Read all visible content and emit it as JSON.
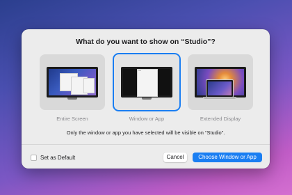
{
  "dialog": {
    "title": "What do you want to show on “Studio”?",
    "options": [
      {
        "label": "Entire Screen",
        "selected": false
      },
      {
        "label": "Window or App",
        "selected": true
      },
      {
        "label": "Extended Display",
        "selected": false
      }
    ],
    "info": "Only the window or app you have selected will be visible on “Studio”.",
    "checkbox": {
      "label": "Set as Default",
      "checked": false
    },
    "buttons": {
      "cancel": "Cancel",
      "primary": "Choose Window or App"
    }
  },
  "colors": {
    "accent": "#1a7ef2",
    "dialog_bg": "#ececec"
  }
}
